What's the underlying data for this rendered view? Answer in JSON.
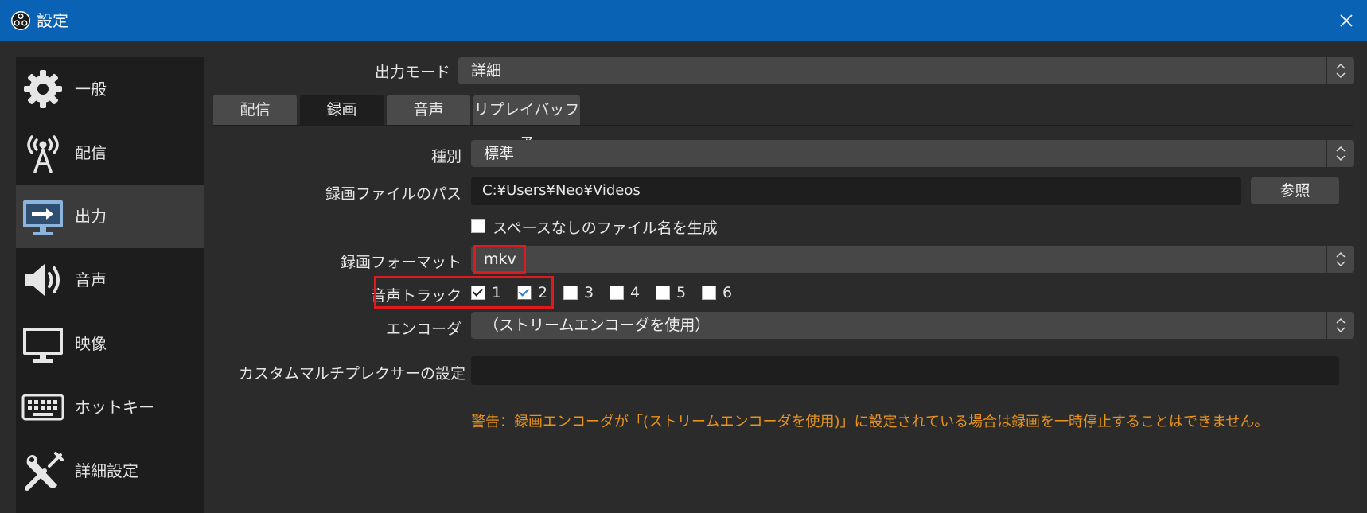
{
  "window": {
    "title": "設定",
    "close_icon": "close-icon",
    "app_icon": "obs-logo-icon"
  },
  "sidebar": {
    "items": [
      {
        "label": "一般",
        "icon": "gear-icon"
      },
      {
        "label": "配信",
        "icon": "broadcast-tower-icon"
      },
      {
        "label": "出力",
        "icon": "monitor-output-icon",
        "active": true
      },
      {
        "label": "音声",
        "icon": "speaker-icon"
      },
      {
        "label": "映像",
        "icon": "monitor-icon"
      },
      {
        "label": "ホットキー",
        "icon": "keyboard-icon"
      },
      {
        "label": "詳細設定",
        "icon": "tools-icon"
      }
    ]
  },
  "output_mode": {
    "label": "出力モード",
    "value": "詳細"
  },
  "tabs": [
    {
      "label": "配信",
      "active": false
    },
    {
      "label": "録画",
      "active": true
    },
    {
      "label": "音声",
      "active": false
    },
    {
      "label": "リプレイバッファ",
      "active": false
    }
  ],
  "recording": {
    "type": {
      "label": "種別",
      "value": "標準"
    },
    "path": {
      "label": "録画ファイルのパス",
      "value": "C:¥Users¥Neo¥Videos",
      "browse_label": "参照"
    },
    "no_space_filename": {
      "label": "スペースなしのファイル名を生成",
      "checked": false
    },
    "format": {
      "label": "録画フォーマット",
      "value": "mkv"
    },
    "audio_tracks": {
      "label": "音声トラック",
      "tracks": [
        {
          "label": "1",
          "checked": true
        },
        {
          "label": "2",
          "checked": true
        },
        {
          "label": "3",
          "checked": false
        },
        {
          "label": "4",
          "checked": false
        },
        {
          "label": "5",
          "checked": false
        },
        {
          "label": "6",
          "checked": false
        }
      ]
    },
    "encoder": {
      "label": "エンコーダ",
      "value": "（ストリームエンコーダを使用）"
    },
    "custom_muxer": {
      "label": "カスタムマルチプレクサーの設定",
      "value": ""
    },
    "warning": "警告：録画エンコーダが「(ストリームエンコーダを使用)」に設定されている場合は録画を一時停止することはできません。"
  },
  "colors": {
    "titlebar": "#0a62b4",
    "background": "#2b2b2b",
    "sidebar": "#1d1d1d",
    "warning": "#e8931c",
    "highlight": "#e0191e"
  }
}
